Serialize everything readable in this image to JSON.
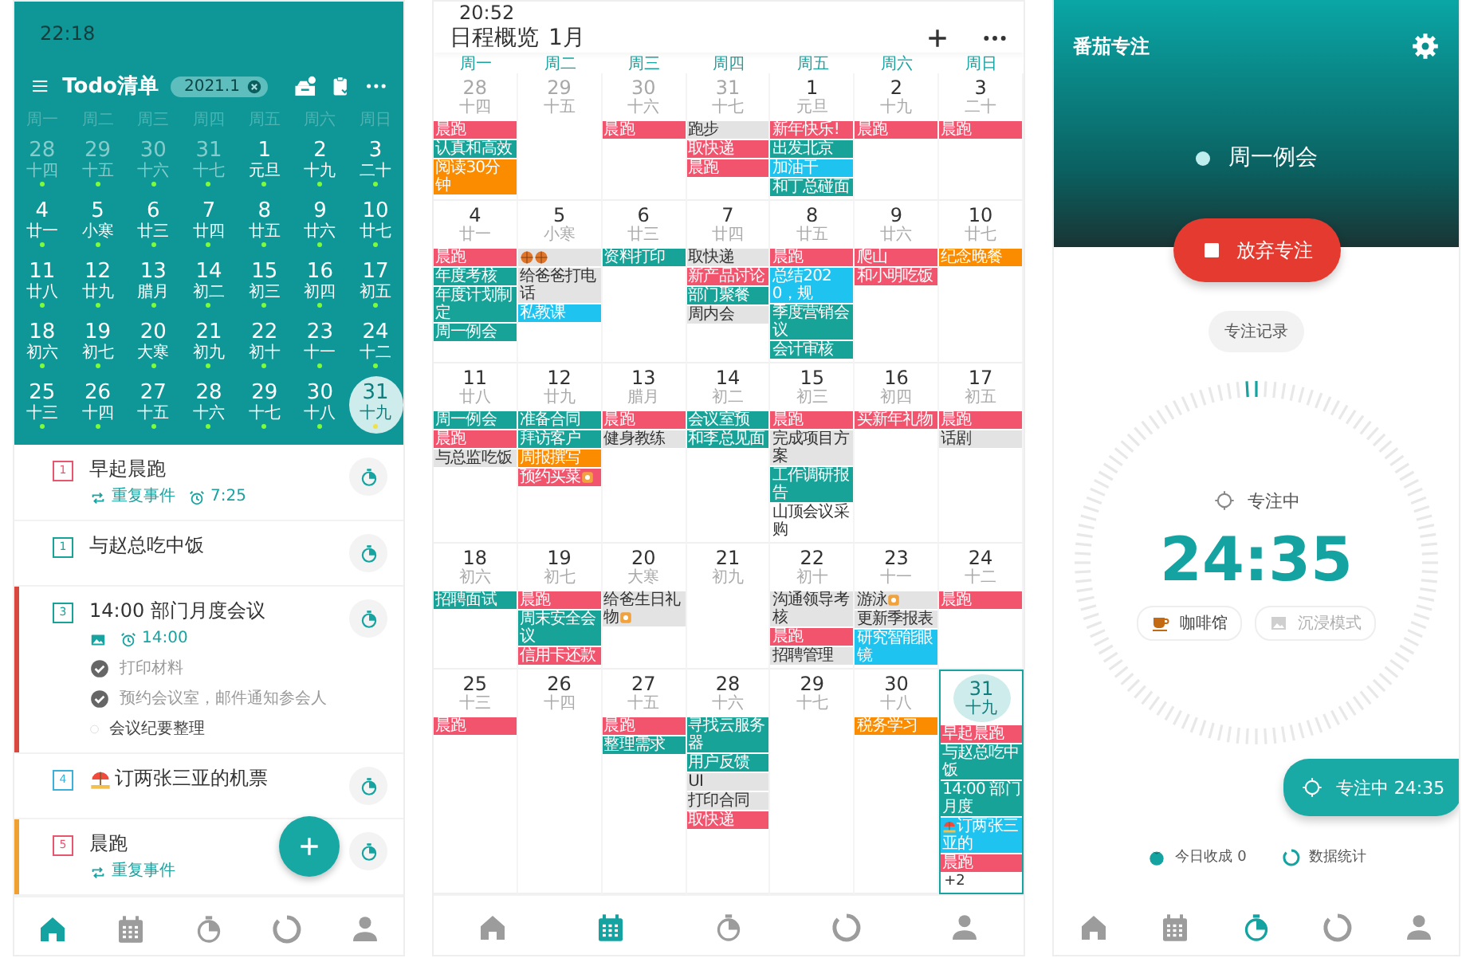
{
  "todo_screen": {
    "status_time": "22:18",
    "title": "Todo清单",
    "month_chip": "2021.1",
    "weekdays": [
      "周一",
      "周二",
      "周三",
      "周四",
      "周五",
      "周六",
      "周日"
    ],
    "weeks": [
      [
        {
          "day": "28",
          "lunar": "十四",
          "outside": true,
          "selected": false
        },
        {
          "day": "29",
          "lunar": "十五",
          "outside": true,
          "selected": false
        },
        {
          "day": "30",
          "lunar": "十六",
          "outside": true,
          "selected": false
        },
        {
          "day": "31",
          "lunar": "十七",
          "outside": true,
          "selected": false
        },
        {
          "day": "1",
          "lunar": "元旦",
          "outside": false,
          "selected": false
        },
        {
          "day": "2",
          "lunar": "十九",
          "outside": false,
          "selected": false
        },
        {
          "day": "3",
          "lunar": "二十",
          "outside": false,
          "selected": false
        }
      ],
      [
        {
          "day": "4",
          "lunar": "廿一",
          "outside": false,
          "selected": false
        },
        {
          "day": "5",
          "lunar": "小寒",
          "outside": false,
          "selected": false
        },
        {
          "day": "6",
          "lunar": "廿三",
          "outside": false,
          "selected": false
        },
        {
          "day": "7",
          "lunar": "廿四",
          "outside": false,
          "selected": false
        },
        {
          "day": "8",
          "lunar": "廿五",
          "outside": false,
          "selected": false
        },
        {
          "day": "9",
          "lunar": "廿六",
          "outside": false,
          "selected": false
        },
        {
          "day": "10",
          "lunar": "廿七",
          "outside": false,
          "selected": false
        }
      ],
      [
        {
          "day": "11",
          "lunar": "廿八",
          "outside": false,
          "selected": false
        },
        {
          "day": "12",
          "lunar": "廿九",
          "outside": false,
          "selected": false
        },
        {
          "day": "13",
          "lunar": "腊月",
          "outside": false,
          "selected": false
        },
        {
          "day": "14",
          "lunar": "初二",
          "outside": false,
          "selected": false
        },
        {
          "day": "15",
          "lunar": "初三",
          "outside": false,
          "selected": false
        },
        {
          "day": "16",
          "lunar": "初四",
          "outside": false,
          "selected": false
        },
        {
          "day": "17",
          "lunar": "初五",
          "outside": false,
          "selected": false
        }
      ],
      [
        {
          "day": "18",
          "lunar": "初六",
          "outside": false,
          "selected": false
        },
        {
          "day": "19",
          "lunar": "初七",
          "outside": false,
          "selected": false
        },
        {
          "day": "20",
          "lunar": "大寒",
          "outside": false,
          "selected": false
        },
        {
          "day": "21",
          "lunar": "初九",
          "outside": false,
          "selected": false
        },
        {
          "day": "22",
          "lunar": "初十",
          "outside": false,
          "selected": false
        },
        {
          "day": "23",
          "lunar": "十一",
          "outside": false,
          "selected": false
        },
        {
          "day": "24",
          "lunar": "十二",
          "outside": false,
          "selected": false
        }
      ],
      [
        {
          "day": "25",
          "lunar": "十三",
          "outside": false,
          "selected": false
        },
        {
          "day": "26",
          "lunar": "十四",
          "outside": false,
          "selected": false
        },
        {
          "day": "27",
          "lunar": "十五",
          "outside": false,
          "selected": false
        },
        {
          "day": "28",
          "lunar": "十六",
          "outside": false,
          "selected": false
        },
        {
          "day": "29",
          "lunar": "十七",
          "outside": false,
          "selected": false
        },
        {
          "day": "30",
          "lunar": "十八",
          "outside": false,
          "selected": false
        },
        {
          "day": "31",
          "lunar": "十九",
          "outside": false,
          "selected": true
        }
      ]
    ],
    "tasks": [
      {
        "number": "1",
        "color": "#e8556f",
        "kind": "text",
        "title": "早起晨跑",
        "meta": [
          {
            "kind": "repeat",
            "text": "重复事件"
          },
          {
            "kind": "alarm",
            "text": "7:25"
          }
        ]
      },
      {
        "number": "1",
        "color": "#17a398",
        "kind": "text",
        "title": "与赵总吃中饭"
      },
      {
        "number": "3",
        "color": "#17a398",
        "flag": {
          "color": "#d9473f"
        },
        "kind": "text",
        "title": "14:00 部门月度会议",
        "meta": [
          {
            "kind": "image"
          },
          {
            "kind": "alarm",
            "text": "14:00"
          }
        ],
        "subtasks": [
          {
            "text": "打印材料",
            "checked": true
          },
          {
            "text": "预约会议室，邮件通知参会人",
            "checked": true
          },
          {
            "text": "会议纪要整理",
            "checked": false
          }
        ]
      },
      {
        "number": "4",
        "color": "#3bb0d9",
        "kind": "icon-before",
        "title": "订两张三亚的机票"
      },
      {
        "number": "5",
        "color": "#e8556f",
        "flag": {
          "color": "#f0a030"
        },
        "kind": "text",
        "title": "晨跑",
        "meta": [
          {
            "kind": "repeat",
            "text": "重复事件"
          }
        ]
      }
    ],
    "nav": [
      {
        "selected": true
      },
      {
        "selected": false
      },
      {
        "selected": false
      },
      {
        "selected": false
      },
      {
        "selected": false
      }
    ]
  },
  "schedule_screen": {
    "status_time": "20:52",
    "title": "日程概览",
    "month": "1月",
    "weekdays": [
      "周一",
      "周二",
      "周三",
      "周四",
      "周五",
      "周六",
      "周日"
    ],
    "weeks": [
      [
        {
          "day": "28",
          "lunar": "十四",
          "outside": true,
          "selected": false,
          "events": [
            {
              "text": "晨跑",
              "color": "#f2546e"
            },
            {
              "text": "认真和高效",
              "color": "#17a398"
            },
            {
              "text": "阅读30分钟",
              "color": "#fb8c00"
            }
          ]
        },
        {
          "day": "29",
          "lunar": "十五",
          "outside": true,
          "selected": false
        },
        {
          "day": "30",
          "lunar": "十六",
          "outside": true,
          "selected": false,
          "events": [
            {
              "text": "晨跑",
              "color": "#f2546e"
            }
          ]
        },
        {
          "day": "31",
          "lunar": "十七",
          "outside": true,
          "selected": false,
          "events": [
            {
              "text": "跑步",
              "color": "#e3e3e3"
            },
            {
              "text": "取快递",
              "color": "#f2546e"
            },
            {
              "text": "晨跑",
              "color": "#f2546e"
            }
          ]
        },
        {
          "day": "1",
          "lunar": "元旦",
          "outside": false,
          "selected": false,
          "events": [
            {
              "text": "新年快乐!",
              "color": "#f2546e"
            },
            {
              "text": "出发北京",
              "color": "#17a398"
            },
            {
              "text": "加油干",
              "color": "#1ec3f0"
            },
            {
              "text": "和丁总碰面",
              "color": "#17a398"
            }
          ]
        },
        {
          "day": "2",
          "lunar": "十九",
          "outside": false,
          "selected": false,
          "events": [
            {
              "text": "晨跑",
              "color": "#f2546e"
            }
          ]
        },
        {
          "day": "3",
          "lunar": "二十",
          "outside": false,
          "selected": false,
          "events": [
            {
              "text": "晨跑",
              "color": "#f2546e"
            }
          ]
        }
      ],
      [
        {
          "day": "4",
          "lunar": "廿一",
          "outside": false,
          "selected": false,
          "events": [
            {
              "text": "晨跑",
              "color": "#f2546e"
            },
            {
              "text": "年度考核",
              "color": "#17a398"
            },
            {
              "text": "年度计划制定",
              "color": "#17a398"
            },
            {
              "text": "周一例会",
              "color": "#17a398"
            }
          ]
        },
        {
          "day": "5",
          "lunar": "小寒",
          "outside": false,
          "selected": false,
          "events": [
            {
              "kind": "icons",
              "color": "#e3e3e3"
            },
            {
              "text": "给爸爸打电话",
              "color": "#e3e3e3"
            },
            {
              "text": "私教课",
              "color": "#1ec3f0"
            }
          ]
        },
        {
          "day": "6",
          "lunar": "廿三",
          "outside": false,
          "selected": false,
          "events": [
            {
              "text": "资料打印",
              "color": "#17a398"
            }
          ]
        },
        {
          "day": "7",
          "lunar": "廿四",
          "outside": false,
          "selected": false,
          "events": [
            {
              "text": "取快递",
              "color": "#e3e3e3"
            },
            {
              "text": "新产品讨论",
              "color": "#f2546e"
            },
            {
              "text": "部门聚餐",
              "color": "#17a398"
            },
            {
              "text": "周内会",
              "color": "#e3e3e3"
            }
          ]
        },
        {
          "day": "8",
          "lunar": "廿五",
          "outside": false,
          "selected": false,
          "events": [
            {
              "text": "晨跑",
              "color": "#f2546e"
            },
            {
              "text": "总结2020，规",
              "color": "#1ec3f0"
            },
            {
              "text": "季度营销会议",
              "color": "#17a398"
            },
            {
              "text": "会计审核",
              "color": "#17a398"
            }
          ]
        },
        {
          "day": "9",
          "lunar": "廿六",
          "outside": false,
          "selected": false,
          "events": [
            {
              "text": "爬山",
              "color": "#f2546e"
            },
            {
              "text": "和小明吃饭",
              "color": "#f2546e"
            }
          ]
        },
        {
          "day": "10",
          "lunar": "廿七",
          "outside": false,
          "selected": false,
          "events": [
            {
              "text": "纪念晚餐",
              "color": "#fb8c00"
            }
          ]
        }
      ],
      [
        {
          "day": "11",
          "lunar": "廿八",
          "outside": false,
          "selected": false,
          "events": [
            {
              "text": "周一例会",
              "color": "#17a398"
            },
            {
              "text": "晨跑",
              "color": "#f2546e"
            },
            {
              "text": "与总监吃饭",
              "color": "#e3e3e3"
            }
          ]
        },
        {
          "day": "12",
          "lunar": "廿九",
          "outside": false,
          "selected": false,
          "events": [
            {
              "text": "准备合同",
              "color": "#17a398"
            },
            {
              "text": "拜访客户",
              "color": "#17a398"
            },
            {
              "text": "周报撰写",
              "color": "#fb8c00"
            },
            {
              "text": "预约买菜",
              "color": "#f2546e",
              "kind": "icon-after"
            }
          ]
        },
        {
          "day": "13",
          "lunar": "腊月",
          "outside": false,
          "selected": false,
          "events": [
            {
              "text": "晨跑",
              "color": "#f2546e"
            },
            {
              "text": "健身教练",
              "color": "#e3e3e3"
            }
          ]
        },
        {
          "day": "14",
          "lunar": "初二",
          "outside": false,
          "selected": false,
          "events": [
            {
              "text": "会议室预",
              "color": "#17a398"
            },
            {
              "text": "和李总见面",
              "color": "#17a398"
            }
          ]
        },
        {
          "day": "15",
          "lunar": "初三",
          "outside": false,
          "selected": false,
          "events": [
            {
              "text": "晨跑",
              "color": "#f2546e"
            },
            {
              "text": "完成项目方案",
              "color": "#e3e3e3"
            },
            {
              "text": "工作调研报告",
              "color": "#17a398"
            },
            {
              "text": "山顶会议采购",
              "color": "#ffffff"
            }
          ]
        },
        {
          "day": "16",
          "lunar": "初四",
          "outside": false,
          "selected": false,
          "events": [
            {
              "text": "买新年礼物",
              "color": "#f2546e"
            }
          ]
        },
        {
          "day": "17",
          "lunar": "初五",
          "outside": false,
          "selected": false,
          "events": [
            {
              "text": "晨跑",
              "color": "#f2546e"
            },
            {
              "text": "话剧",
              "color": "#e3e3e3"
            }
          ]
        }
      ],
      [
        {
          "day": "18",
          "lunar": "初六",
          "outside": false,
          "selected": false,
          "events": [
            {
              "text": "招聘面试",
              "color": "#17a398"
            }
          ]
        },
        {
          "day": "19",
          "lunar": "初七",
          "outside": false,
          "selected": false,
          "events": [
            {
              "text": "晨跑",
              "color": "#f2546e"
            },
            {
              "text": "周末安全会议",
              "color": "#17a398"
            },
            {
              "text": "信用卡还款",
              "color": "#f2546e"
            }
          ]
        },
        {
          "day": "20",
          "lunar": "大寒",
          "outside": false,
          "selected": false,
          "events": [
            {
              "text": "给爸生日礼物",
              "color": "#e3e3e3",
              "kind": "icon-after"
            }
          ]
        },
        {
          "day": "21",
          "lunar": "初九",
          "outside": false,
          "selected": false
        },
        {
          "day": "22",
          "lunar": "初十",
          "outside": false,
          "selected": false,
          "events": [
            {
              "text": "沟通领导考核",
              "color": "#e3e3e3"
            },
            {
              "text": "晨跑",
              "color": "#f2546e"
            },
            {
              "text": "招聘管理",
              "color": "#e3e3e3"
            }
          ]
        },
        {
          "day": "23",
          "lunar": "十一",
          "outside": false,
          "selected": false,
          "events": [
            {
              "text": "游泳",
              "color": "#e3e3e3",
              "kind": "icon-after"
            },
            {
              "text": "更新季报表",
              "color": "#e3e3e3"
            },
            {
              "text": "研究智能眼镜",
              "color": "#1ec3f0"
            }
          ]
        },
        {
          "day": "24",
          "lunar": "十二",
          "outside": false,
          "selected": false,
          "events": [
            {
              "text": "晨跑",
              "color": "#f2546e"
            }
          ]
        }
      ],
      [
        {
          "day": "25",
          "lunar": "十三",
          "outside": false,
          "selected": false,
          "events": [
            {
              "text": "晨跑",
              "color": "#f2546e"
            }
          ]
        },
        {
          "day": "26",
          "lunar": "十四",
          "outside": false,
          "selected": false
        },
        {
          "day": "27",
          "lunar": "十五",
          "outside": false,
          "selected": false,
          "events": [
            {
              "text": "晨跑",
              "color": "#f2546e"
            },
            {
              "text": "整理需求",
              "color": "#17a398"
            }
          ]
        },
        {
          "day": "28",
          "lunar": "十六",
          "outside": false,
          "selected": false,
          "events": [
            {
              "text": "寻找云服务器",
              "color": "#17a398"
            },
            {
              "text": "用户反馈",
              "color": "#17a398"
            },
            {
              "text": "UI",
              "color": "#e3e3e3"
            },
            {
              "text": "打印合同",
              "color": "#e3e3e3"
            },
            {
              "text": "取快递",
              "color": "#f2546e"
            }
          ]
        },
        {
          "day": "29",
          "lunar": "十七",
          "outside": false,
          "selected": false
        },
        {
          "day": "30",
          "lunar": "十八",
          "outside": false,
          "selected": false,
          "events": [
            {
              "text": "税务学习",
              "color": "#fb8c00"
            }
          ]
        },
        {
          "day": "31",
          "lunar": "十九",
          "outside": false,
          "selected": true,
          "events": [
            {
              "text": "早起晨跑",
              "color": "#f2546e"
            },
            {
              "text": "与赵总吃中饭",
              "color": "#17a398"
            },
            {
              "text": "14:00 部门月度",
              "color": "#17a398"
            },
            {
              "text": "订两张三亚的",
              "color": "#1ec3f0",
              "kind": "icon-before"
            },
            {
              "text": "晨跑",
              "color": "#f2546e"
            }
          ],
          "more": "+2"
        }
      ]
    ],
    "nav": [
      {
        "selected": false
      },
      {
        "selected": true
      },
      {
        "selected": false
      },
      {
        "selected": false
      },
      {
        "selected": false
      }
    ]
  },
  "focus_screen": {
    "title": "番茄专注",
    "task": "周一例会",
    "stop_button": "放弃专注",
    "record_button": "专注记录",
    "state_label": "专注中",
    "timer": "24:35",
    "chips": [
      {
        "text": "咖啡馆",
        "disabled": false
      },
      {
        "text": "沉浸模式",
        "disabled": true
      }
    ],
    "floating": {
      "label": "专注中",
      "time": "24:35"
    },
    "stats": [
      {
        "text": "今日收成 0"
      },
      {
        "text": "数据统计"
      }
    ],
    "nav": [
      {
        "selected": false
      },
      {
        "selected": false
      },
      {
        "selected": true
      },
      {
        "selected": false
      },
      {
        "selected": false
      }
    ]
  }
}
